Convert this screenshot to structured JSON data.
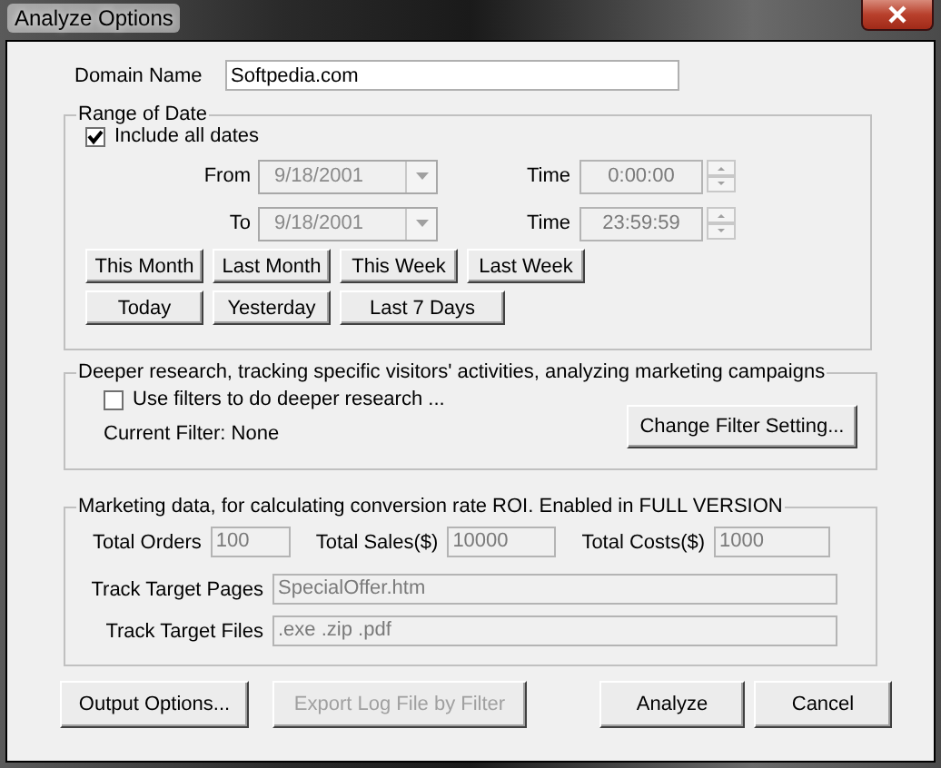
{
  "window": {
    "title": "Analyze Options"
  },
  "domain": {
    "label": "Domain Name",
    "value": "Softpedia.com"
  },
  "date_range": {
    "legend": "Range of Date",
    "include_all": {
      "label": "Include all dates",
      "checked": true
    },
    "rows": [
      {
        "label": "From",
        "date": "9/18/2001",
        "time_label": "Time",
        "time": "0:00:00",
        "disabled": true
      },
      {
        "label": "To",
        "date": "9/18/2001",
        "time_label": "Time",
        "time": "23:59:59",
        "disabled": true
      }
    ],
    "button_rows": [
      {
        "buttons": [
          {
            "label": "This Month",
            "wide": false
          },
          {
            "label": "Last Month",
            "wide": false
          },
          {
            "label": "This Week",
            "wide": false
          },
          {
            "label": "Last Week",
            "wide": false
          }
        ]
      },
      {
        "buttons": [
          {
            "label": "Today",
            "wide": false
          },
          {
            "label": "Yesterday",
            "wide": false
          },
          {
            "label": "Last 7 Days",
            "wide": true
          }
        ]
      }
    ]
  },
  "research": {
    "legend": "Deeper research, tracking specific visitors' activities, analyzing marketing campaigns",
    "use_filters": {
      "label": "Use filters to do deeper research ...",
      "checked": false
    },
    "current_filter": "Current Filter: None",
    "button": "Change Filter Setting..."
  },
  "marketing": {
    "legend": "Marketing data, for calculating conversion rate  ROI. Enabled in FULL VERSION",
    "totals": [
      {
        "label": "Total Orders",
        "value": "100",
        "disabled": true
      },
      {
        "label": "Total Sales($)",
        "value": "10000",
        "disabled": true
      },
      {
        "label": "Total Costs($)",
        "value": "1000",
        "disabled": true
      }
    ],
    "tracks": [
      {
        "label": "Track Target Pages",
        "value": "SpecialOffer.htm",
        "disabled": true
      },
      {
        "label": "Track Target Files",
        "value": ".exe .zip .pdf",
        "disabled": true
      }
    ]
  },
  "buttons": [
    {
      "label": "Output Options...",
      "disabled": false
    },
    {
      "label": "Export Log File by Filter",
      "disabled": true
    },
    {
      "label": "Analyze",
      "disabled": false
    },
    {
      "label": "Cancel",
      "disabled": false
    }
  ]
}
